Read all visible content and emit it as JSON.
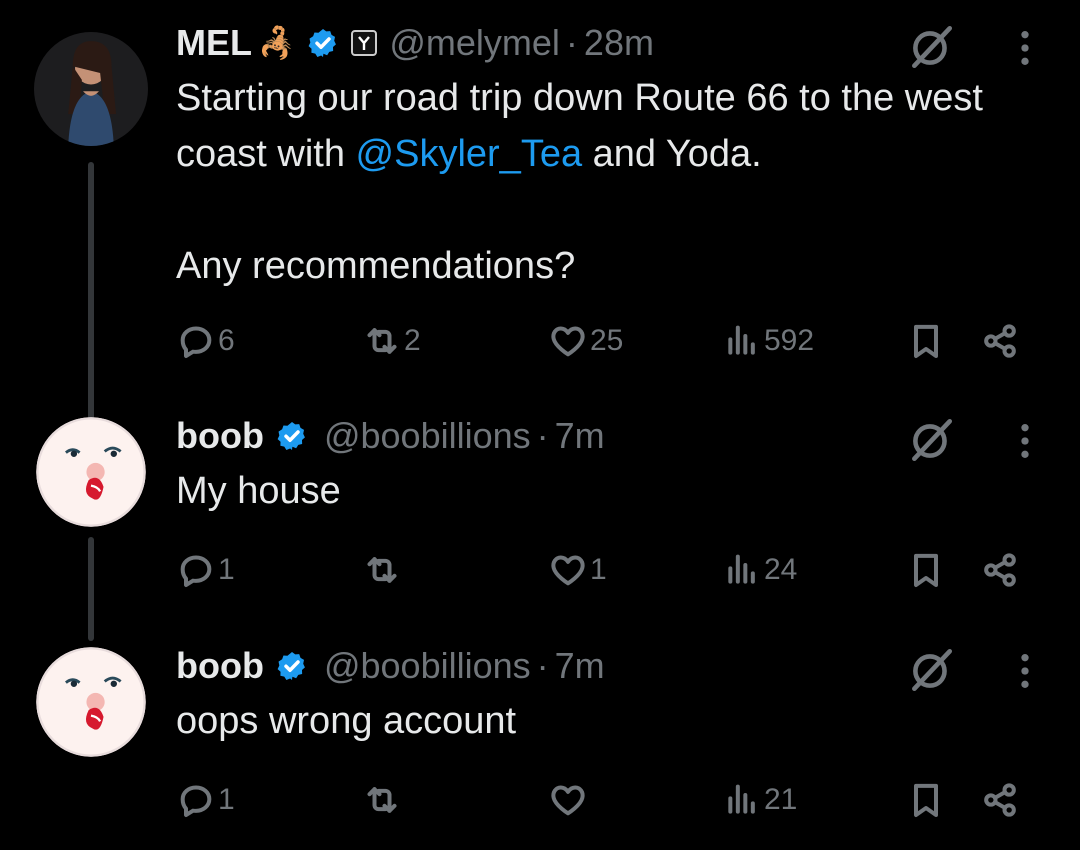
{
  "tweets": [
    {
      "name": "MEL",
      "emoji": "🦂",
      "handle": "@melymel",
      "time": "28m",
      "text_before": "Starting our road trip down Route 66 to the west coast with ",
      "mention": "@Skyler_Tea",
      "text_after": " and Yoda.\n\nAny recommendations?",
      "replies": "6",
      "reposts": "2",
      "likes": "25",
      "views": "592"
    },
    {
      "name": "boob",
      "handle": "@boobillions",
      "time": "7m",
      "text": "My house",
      "replies": "1",
      "reposts": "",
      "likes": "1",
      "views": "24"
    },
    {
      "name": "boob",
      "handle": "@boobillions",
      "time": "7m",
      "text": "oops wrong account",
      "replies": "1",
      "reposts": "",
      "likes": "",
      "views": "21"
    }
  ],
  "dot": "·",
  "colors": {
    "background": "#000000",
    "text": "#e7e9ea",
    "muted": "#71767b",
    "accent": "#1d9bf0"
  }
}
